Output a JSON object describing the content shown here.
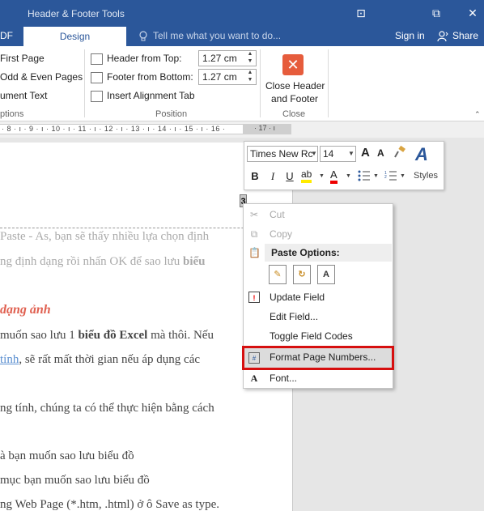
{
  "titlebar": {
    "context_title": "Header & Footer Tools",
    "restore_glyph": "⧉",
    "close_glyph": "✕",
    "ribbon_display_glyph": "⊡"
  },
  "tabs": {
    "partial_left": "DF",
    "design": "Design",
    "tell_me": "Tell me what you want to do...",
    "sign_in": "Sign in",
    "share": "Share"
  },
  "ribbon": {
    "options": {
      "items": [
        "First Page",
        "Odd & Even Pages",
        "ument Text"
      ],
      "group_label": "ptions"
    },
    "position": {
      "header_from_top_label": "Header from Top:",
      "header_from_top_value": "1.27 cm",
      "footer_from_bottom_label": "Footer from Bottom:",
      "footer_from_bottom_value": "1.27 cm",
      "insert_alignment_tab": "Insert Alignment Tab",
      "group_label": "Position"
    },
    "close": {
      "button_line1": "Close Header",
      "button_line2": "and Footer",
      "group_label": "Close"
    }
  },
  "ruler": {
    "text": "· 8 · ı · 9 · ı · 10 · ı · 11 · ı · 12 · ı · 13 · ı · 14 · ı · 15 · ı · 16 ·",
    "end": "· 17 · ı"
  },
  "document": {
    "page_number": "3",
    "lines": [
      "Paste - As, bạn sẽ thấy nhiều lựa chọn định",
      "ng định dạng rồi nhấn OK để sao lưu ",
      "muốn sao lưu 1 ",
      "thôi. Nếu",
      "tính",
      ", sẽ rất mất thời gian nếu áp dụng các",
      "ng tính, chúng ta có thể thực hiện bằng cách",
      "à bạn muốn sao lưu biểu đồ",
      "mục bạn muốn sao lưu biểu đồ",
      "ng Web Page (*.htm, .html) ở ô Save as type."
    ],
    "bold_bieu": "biểu",
    "heading": "dạng ảnh",
    "bold_chart": "biểu đồ Excel",
    "mid_text": " mà thôi. Nếu"
  },
  "mini_toolbar": {
    "font_name": "Times New Rc",
    "font_size": "14",
    "grow_font": "A",
    "shrink_font": "A",
    "bold": "B",
    "italic": "I",
    "underline": "U",
    "highlight": "ab",
    "font_color": "A",
    "styles": "Styles"
  },
  "context_menu": {
    "cut": "Cut",
    "copy": "Copy",
    "paste_options": "Paste Options:",
    "update_field": "Update Field",
    "edit_field": "Edit Field...",
    "toggle_field_codes": "Toggle Field Codes",
    "format_page_numbers": "Format Page Numbers...",
    "font": "Font..."
  },
  "colors": {
    "ribbon_blue": "#2b579a",
    "highlight_red": "#d60f0f",
    "close_icon": "#e65c3c",
    "heading_red": "#e06050"
  }
}
